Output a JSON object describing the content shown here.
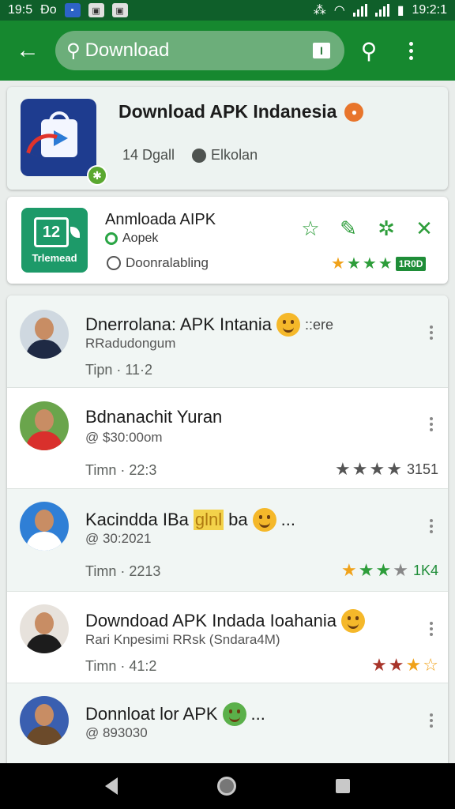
{
  "status": {
    "time_left": "19:5",
    "carrier": "Ɖo",
    "clock": "19:2:1",
    "extra": "ꀀꀀ"
  },
  "topbar": {
    "search_value": "Download",
    "kbd_label": "I"
  },
  "featured": {
    "title": "Download APK Indanesia",
    "meta_size": "14 Dgall",
    "meta_author": "Elkolan"
  },
  "app2": {
    "icon_number": "12",
    "icon_label": "Trlemead",
    "title": "Anmloada AIPK",
    "subtitle": "Aopek",
    "status": "Doonralabling",
    "rating_badge": "1R0D"
  },
  "rows": [
    {
      "title": "Dnerrolana: APK Intania",
      "title_suffix": "::ere",
      "subtitle": "RRadudongum",
      "time": "Tipn · 11·2",
      "rating_text": "",
      "colors": {
        "body": "#1f2a44",
        "bg": "#cfd8e0"
      }
    },
    {
      "title": "Bdnanachit Yuran",
      "title_suffix": "",
      "subtitle": "@ $30:00om",
      "time": "Timn · 22:3",
      "rating_text": "3151",
      "colors": {
        "body": "#d9302c",
        "bg": "#6aa54c"
      }
    },
    {
      "title": "Kacindda IBa",
      "title_hl": "glnl",
      "title_tail": "ba",
      "title_suffix": "...",
      "subtitle": "@ 30:2021",
      "time": "Timn · 2213",
      "rating_text": "1K4",
      "colors": {
        "body": "#ffffff",
        "bg": "#2f7fd6"
      }
    },
    {
      "title": "Downdoad APK Indada Ioahania",
      "title_suffix": "",
      "subtitle": "Rari Knpesimi RRsk (Sndara4M)",
      "time": "Timn · 41:2",
      "rating_text": "",
      "colors": {
        "body": "#1c1c1c",
        "bg": "#e7e2dc"
      }
    },
    {
      "title": "Donnloat lor APK",
      "title_suffix": "...",
      "subtitle": "@ 893030",
      "time": "",
      "rating_text": "",
      "colors": {
        "body": "#6b4a2a",
        "bg": "#3a5fb0"
      }
    }
  ],
  "colors": {
    "status_bar": "#0f5f2a",
    "app_bar": "#16882f",
    "accent_green": "#2d9d3a",
    "star_gold": "#f0a21a",
    "star_gray": "#555555"
  }
}
